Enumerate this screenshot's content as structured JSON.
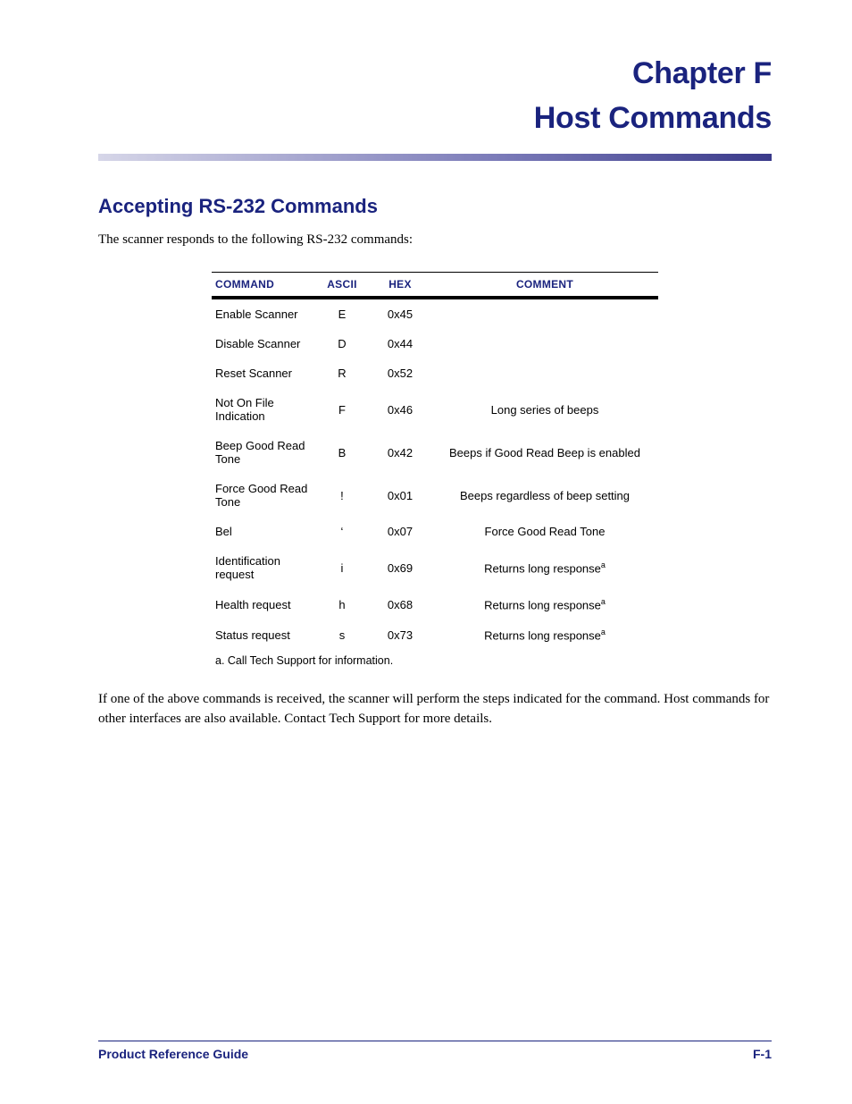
{
  "chapter": {
    "line1": "Chapter F",
    "line2": "Host Commands"
  },
  "section_title": "Accepting RS-232 Commands",
  "intro": "The scanner responds to the following RS-232 commands:",
  "headers": {
    "command": "COMMAND",
    "ascii": "ASCII",
    "hex": "HEX",
    "comment": "COMMENT"
  },
  "rows": [
    {
      "command": "Enable Scanner",
      "ascii": "E",
      "hex": "0x45",
      "comment": "",
      "sup": false
    },
    {
      "command": "Disable Scanner",
      "ascii": "D",
      "hex": "0x44",
      "comment": "",
      "sup": false
    },
    {
      "command": "Reset Scanner",
      "ascii": "R",
      "hex": "0x52",
      "comment": "",
      "sup": false
    },
    {
      "command": "Not On File Indication",
      "ascii": "F",
      "hex": "0x46",
      "comment": "Long series of beeps",
      "sup": false
    },
    {
      "command": "Beep Good Read Tone",
      "ascii": "B",
      "hex": "0x42",
      "comment": "Beeps if Good Read Beep is enabled",
      "sup": false
    },
    {
      "command": "Force Good Read Tone",
      "ascii": "!",
      "hex": "0x01",
      "comment": "Beeps regardless of beep setting",
      "sup": false
    },
    {
      "command": "Bel",
      "ascii": "‘",
      "hex": "0x07",
      "comment": "Force Good Read Tone",
      "sup": false
    },
    {
      "command": "Identification request",
      "ascii": "i",
      "hex": "0x69",
      "comment": "Returns long response",
      "sup": true
    },
    {
      "command": "Health request",
      "ascii": "h",
      "hex": "0x68",
      "comment": "Returns long response",
      "sup": true
    },
    {
      "command": "Status request",
      "ascii": "s",
      "hex": "0x73",
      "comment": "Returns long response",
      "sup": true
    }
  ],
  "footnote": {
    "marker": "a.",
    "text": "Call Tech Support for information."
  },
  "outro": "If one of the above commands is received, the scanner will perform the steps indicated for the command. Host commands for other interfaces are also available. Contact Tech Support for more details.",
  "footer": {
    "left": "Product Reference Guide",
    "right": "F-1"
  }
}
